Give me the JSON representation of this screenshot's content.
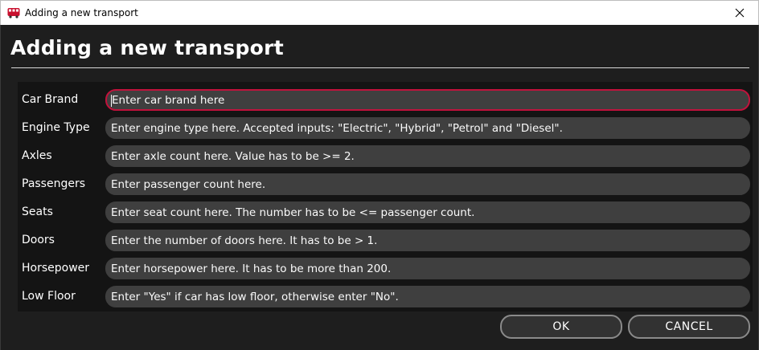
{
  "window": {
    "title": "Adding a new transport",
    "icon": "bus-icon",
    "accent_color": "#c1123c"
  },
  "heading": "Adding a new transport",
  "fields": [
    {
      "label": "Car Brand",
      "placeholder": "Enter car brand here"
    },
    {
      "label": "Engine Type",
      "placeholder": "Enter engine type here. Accepted inputs: \"Electric\", \"Hybrid\", \"Petrol\" and \"Diesel\"."
    },
    {
      "label": "Axles",
      "placeholder": "Enter axle count here. Value has to be >= 2."
    },
    {
      "label": "Passengers",
      "placeholder": "Enter passenger count here."
    },
    {
      "label": "Seats",
      "placeholder": "Enter seat count here. The number has to be <= passenger count."
    },
    {
      "label": "Doors",
      "placeholder": "Enter the number of doors here. It has to be > 1."
    },
    {
      "label": "Horsepower",
      "placeholder": "Enter horsepower here. It has to be more than 200."
    },
    {
      "label": "Low Floor",
      "placeholder": "Enter \"Yes\" if car has low floor, otherwise enter \"No\"."
    }
  ],
  "buttons": {
    "ok": "OK",
    "cancel": "CANCEL"
  }
}
